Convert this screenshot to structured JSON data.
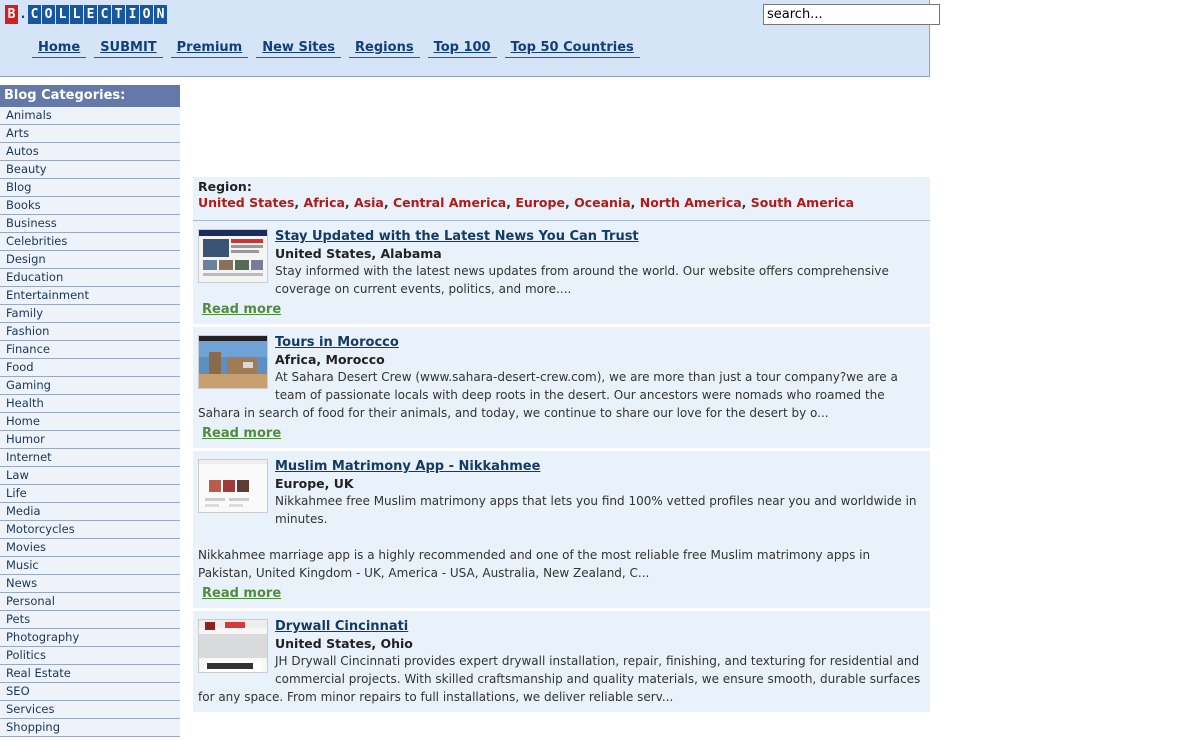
{
  "logo": {
    "letters": [
      "B",
      ".",
      "C",
      "O",
      "L",
      "L",
      "E",
      "C",
      "T",
      "I",
      "O",
      "N"
    ]
  },
  "search": {
    "placeholder": "search..."
  },
  "nav": [
    "Home",
    "SUBMIT",
    "Premium",
    "New Sites",
    "Regions",
    "Top 100",
    "Top 50 Countries"
  ],
  "sidebar": {
    "title": "Blog Categories:",
    "items": [
      "Animals",
      "Arts",
      "Autos",
      "Beauty",
      "Blog",
      "Books",
      "Business",
      "Celebrities",
      "Design",
      "Education",
      "Entertainment",
      "Family",
      "Fashion",
      "Finance",
      "Food",
      "Gaming",
      "Health",
      "Home",
      "Humor",
      "Internet",
      "Law",
      "Life",
      "Media",
      "Motorcycles",
      "Movies",
      "Music",
      "News",
      "Personal",
      "Pets",
      "Photography",
      "Politics",
      "Real Estate",
      "SEO",
      "Services",
      "Shopping"
    ]
  },
  "region": {
    "label": "Region:",
    "links": [
      "United States",
      "Africa",
      "Asia",
      "Central America",
      "Europe",
      "Oceania",
      "North America",
      "South America"
    ]
  },
  "listings": [
    {
      "title": "Stay Updated with the Latest News You Can Trust",
      "location": "United States, Alabama",
      "desc": "Stay informed with the latest news updates from around the world. Our website offers comprehensive coverage on current events, politics, and more....",
      "desc2": "",
      "read_more": "Read more",
      "thumb": "news-thumbnail"
    },
    {
      "title": "Tours in Morocco",
      "location": "Africa, Morocco",
      "desc": "At Sahara Desert Crew (www.sahara-desert-crew.com), we are more than just a tour company?we are a team of passionate locals with deep roots in the desert. Our ancestors were nomads who roamed the Sahara in search of food for their animals, and today, we continue to share our love for the desert by o...",
      "desc2": "",
      "read_more": "Read more",
      "thumb": "morocco-thumbnail"
    },
    {
      "title": "Muslim Matrimony App - Nikkahmee",
      "location": "Europe, UK",
      "desc": "Nikkahmee free Muslim matrimony apps that lets you find 100% vetted profiles near you and worldwide in minutes.",
      "desc2": "Nikkahmee marriage app is a highly recommended and one of the most reliable free Muslim matrimony apps in Pakistan, United Kingdom - UK, America - USA, Australia, New Zealand, C...",
      "read_more": "Read more",
      "thumb": "matrimony-thumbnail"
    },
    {
      "title": "Drywall Cincinnati",
      "location": "United States, Ohio",
      "desc": "JH Drywall Cincinnati provides expert drywall installation, repair, finishing, and texturing for residential and commercial projects. With skilled craftsmanship and quality materials, we ensure smooth, durable surfaces for any space. From minor repairs to full installations, we deliver reliable serv...",
      "desc2": "",
      "read_more": "",
      "thumb": "drywall-thumbnail"
    }
  ],
  "colors": {
    "header_bg": "#d6e4f7",
    "sidebar_title_bg": "#6479a9",
    "region_link": "#b11a16",
    "read_more": "#4f8d3c",
    "logo_red": "#d21f1f",
    "logo_blue": "#17579f"
  }
}
